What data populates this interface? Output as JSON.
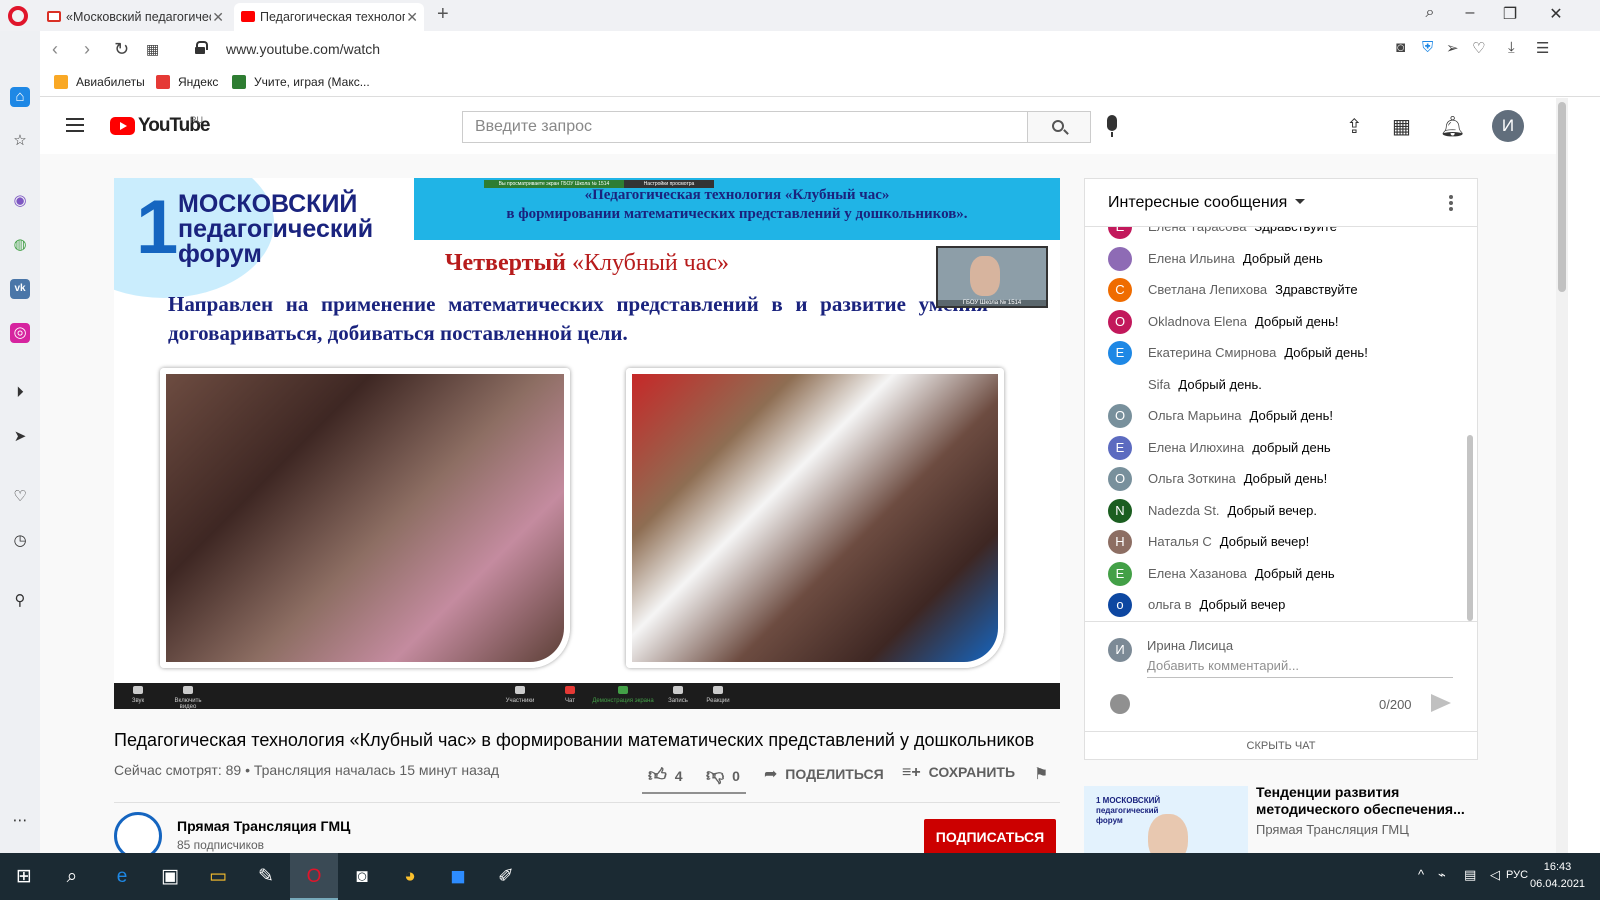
{
  "browser": {
    "tabs": [
      {
        "title": "«Московский педагогический",
        "active": false,
        "favicon": "gmail-icon"
      },
      {
        "title": "Педагогическая технология",
        "active": true,
        "favicon": "youtube-icon"
      }
    ],
    "url": "www.youtube.com/watch",
    "bookmarks": [
      {
        "label": "Авиабилеты",
        "icon": "plane-icon"
      },
      {
        "label": "Яндекс",
        "icon": "yandex-icon"
      },
      {
        "label": "Учите, играя (Макс..."
      }
    ]
  },
  "youtube": {
    "logo_text": "YouTube",
    "region": "RU",
    "search_placeholder": "Введите запрос",
    "avatar_letter": "И"
  },
  "video": {
    "banner_line1": "«Педагогическая технология «Клубный час»",
    "banner_line2": "в формировании  математических представлений у дошкольников».",
    "logo_num": "1",
    "logo_line1": "МОСКОВСКИЙ",
    "logo_line2": "педагогический",
    "logo_line3": "форум",
    "heading_a": "Четвертый",
    "heading_b": "«Клубный час»",
    "body": "Направлен на применение математических представлений в и развитие умения договариваться, добиваться поставленной цели.",
    "cam_label": "ГБОУ Школа № 1514",
    "zoom_banner": "Вы просматриваете экран ГБОУ Школа № 1514",
    "zoom_settings": "Настройки просмотра",
    "zoom_buttons": [
      "Звук",
      "Включить видео",
      "Участники",
      "Чат",
      "Демонстрация экрана",
      "Запись",
      "Реакции"
    ]
  },
  "info": {
    "title": "Педагогическая технология «Клубный час» в формировании математических представлений у дошкольников",
    "meta": "Сейчас смотрят: 89 • Трансляция началась 15 минут назад",
    "likes": "4",
    "dislikes": "0",
    "share": "ПОДЕЛИТЬСЯ",
    "save": "СОХРАНИТЬ",
    "channel": "Прямая Трансляция ГМЦ",
    "subscribers": "85 подписчиков",
    "subscribe": "ПОДПИСАТЬСЯ"
  },
  "chat": {
    "header": "Интересные сообщения",
    "messages": [
      {
        "initial": "Е",
        "author": "Елена Тарасова",
        "text": "Здравствуйте",
        "color": "#c2185b"
      },
      {
        "initial": "",
        "author": "Елена Ильина",
        "text": "Добрый день",
        "color": "#8e6bb5"
      },
      {
        "initial": "С",
        "author": "Светлана Лепихова",
        "text": "Здравствуйте",
        "color": "#ef6c00"
      },
      {
        "initial": "O",
        "author": "Okladnova Elena",
        "text": "Добрый день!",
        "color": "#c2185b"
      },
      {
        "initial": "Е",
        "author": "Екатерина Смирнова",
        "text": "Добрый день!",
        "color": "#1e88e5"
      },
      {
        "initial": "",
        "author": "Sifa",
        "text": "Добрый день.",
        "color": "#ffffff"
      },
      {
        "initial": "О",
        "author": "Ольга Марьина",
        "text": "Добрый день!",
        "color": "#78909c"
      },
      {
        "initial": "Е",
        "author": "Елена Илюхина",
        "text": "добрый день",
        "color": "#5c6bc0"
      },
      {
        "initial": "О",
        "author": "Ольга Зоткина",
        "text": "Добрый день!",
        "color": "#78909c"
      },
      {
        "initial": "N",
        "author": "Nadezda St.",
        "text": "Добрый вечер.",
        "color": "#1b5e20"
      },
      {
        "initial": "Н",
        "author": "Наталья С",
        "text": "Добрый вечер!",
        "color": "#8d6e63"
      },
      {
        "initial": "Е",
        "author": "Елена Хазанова",
        "text": "Добрый день",
        "color": "#43a047"
      },
      {
        "initial": "о",
        "author": "ольга в",
        "text": "Добрый вечер",
        "color": "#0d47a1"
      }
    ],
    "input_name": "Ирина Лисица",
    "input_initial": "И",
    "input_placeholder": "Добавить комментарий...",
    "counter": "0/200",
    "hide": "СКРЫТЬ ЧАТ"
  },
  "related": {
    "title": "Тенденции развития методического обеспечения...",
    "channel": "Прямая Трансляция ГМЦ",
    "thumb_logo": "1 МОСКОВСКИЙ педагогический форум"
  },
  "taskbar": {
    "lang": "РУС",
    "time": "16:43",
    "date": "06.04.2021"
  }
}
